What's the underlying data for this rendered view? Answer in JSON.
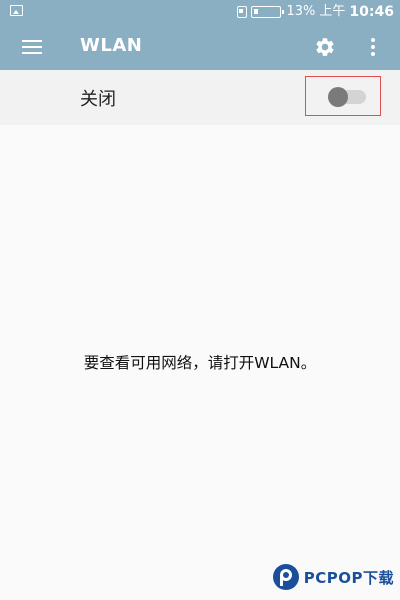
{
  "status_bar": {
    "battery_percent": "13%",
    "period": "上午",
    "time": "10:46"
  },
  "app_bar": {
    "title": "WLAN"
  },
  "wlan_toggle": {
    "label": "关闭",
    "enabled": false
  },
  "content": {
    "empty_message": "要查看可用网络，请打开WLAN。"
  },
  "watermark": {
    "text": "PCPOP下载"
  },
  "colors": {
    "primary": "#8aaec2",
    "highlight": "#e05050"
  }
}
